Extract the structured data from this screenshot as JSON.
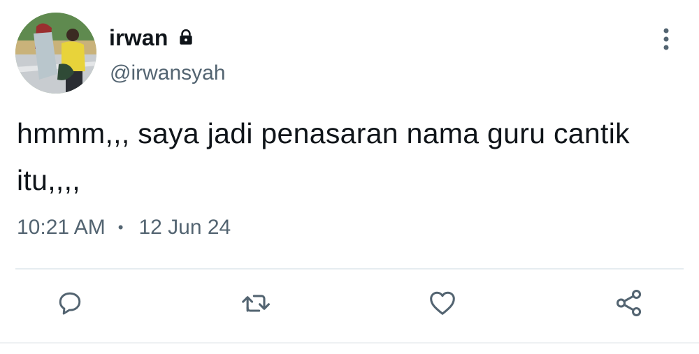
{
  "author": {
    "display_name": "irwan",
    "handle": "@irwansyah",
    "protected_icon": "lock-icon",
    "avatar": "profile-photo"
  },
  "tweet": {
    "text": "hmmm,,, saya jadi penasaran nama guru cantik itu,,,,",
    "time": "10:21 AM",
    "separator": "•",
    "date": "12 Jun 24"
  },
  "actions": {
    "reply_icon": "reply-icon",
    "retweet_icon": "retweet-icon",
    "like_icon": "heart-icon",
    "share_icon": "share-icon"
  },
  "colors": {
    "text_primary": "#0f1419",
    "text_secondary": "#536471",
    "icon": "#536471",
    "divider": "#e6ecf0"
  }
}
